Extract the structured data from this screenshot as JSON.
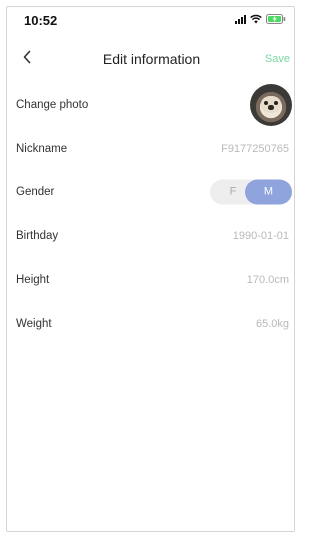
{
  "status_bar": {
    "time": "10:52"
  },
  "nav": {
    "title": "Edit information",
    "save_label": "Save"
  },
  "rows": {
    "photo": {
      "label": "Change photo"
    },
    "nickname": {
      "label": "Nickname",
      "value": "F9177250765"
    },
    "gender": {
      "label": "Gender",
      "options": [
        "F",
        "M"
      ],
      "selected": "M"
    },
    "birthday": {
      "label": "Birthday",
      "value": "1990-01-01"
    },
    "height": {
      "label": "Height",
      "value": "170.0cm"
    },
    "weight": {
      "label": "Weight",
      "value": "65.0kg"
    }
  },
  "colors": {
    "accent_save": "#7cd6a4",
    "toggle_selected": "#8fa3dd",
    "value_text": "#b9b9b9"
  }
}
